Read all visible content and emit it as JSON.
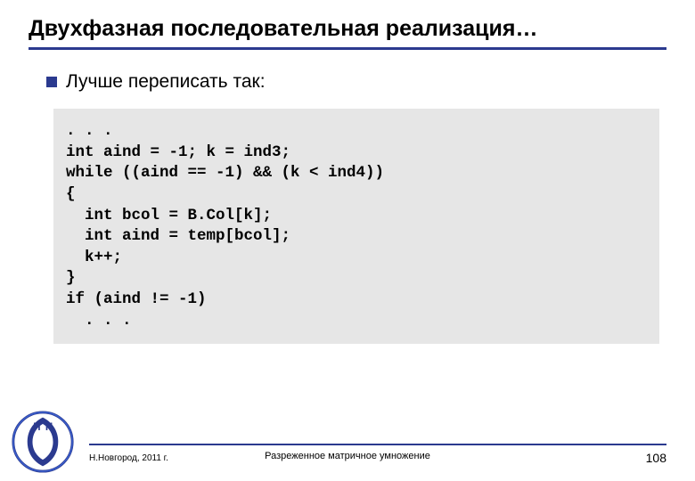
{
  "title": "Двухфазная последовательная реализация…",
  "bullet": {
    "text": "Лучше переписать так:"
  },
  "code": ". . .\nint aind = -1; k = ind3;\nwhile ((aind == -1) && (k < ind4))\n{\n  int bcol = B.Col[k];\n  int aind = temp[bcol];\n  k++;\n}\nif (aind != -1)\n  . . .",
  "footer": {
    "left": "Н.Новгород, 2011 г.",
    "center": "Разреженное матричное умножение",
    "pageNumber": "108"
  },
  "colors": {
    "accent": "#2b3a8f",
    "codeBg": "#e6e6e6"
  }
}
